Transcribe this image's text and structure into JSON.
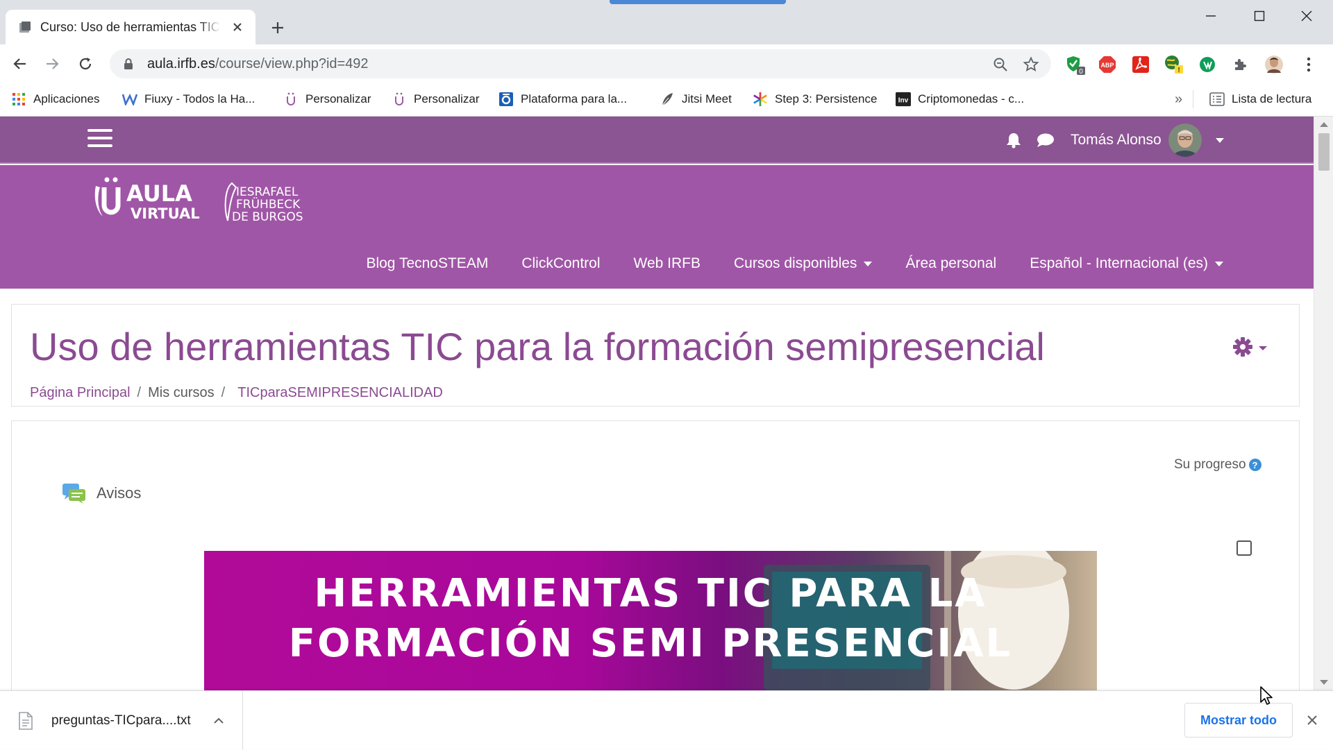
{
  "browser": {
    "tab_title": "Curso: Uso de herramientas TIC para la formación semipresencial",
    "url_host": "aula.irfb.es",
    "url_path": "/course/view.php?id=492",
    "bookmarks": [
      {
        "label": "Aplicaciones",
        "icon": "apps-grid-icon"
      },
      {
        "label": "Fiuxy - Todos la Ha...",
        "icon": "w-logo-icon"
      },
      {
        "label": "Personalizar",
        "icon": "u-logo-icon"
      },
      {
        "label": "Personalizar",
        "icon": "u-logo-icon"
      },
      {
        "label": "Plataforma para la...",
        "icon": "o-logo-icon"
      },
      {
        "label": "Jitsi Meet",
        "icon": "feather-icon"
      },
      {
        "label": "Step 3: Persistence",
        "icon": "star-burst-icon"
      },
      {
        "label": "Criptomonedas - c...",
        "icon": "inv-logo-icon"
      }
    ],
    "reading_list_label": "Lista de lectura",
    "overflow_label": "»",
    "extension_badge": "0"
  },
  "moodle": {
    "user_name": "Tomás Alonso",
    "logo_text": [
      "AULA",
      "VIRTUAL"
    ],
    "school_logo_text": [
      "IESRAFAEL",
      "FRÜHBECK",
      "DE BURGOS"
    ],
    "menu": [
      {
        "label": "Blog TecnoSTEAM",
        "dropdown": false
      },
      {
        "label": "ClickControl",
        "dropdown": false
      },
      {
        "label": "Web IRFB",
        "dropdown": false
      },
      {
        "label": "Cursos disponibles",
        "dropdown": true
      },
      {
        "label": "Área personal",
        "dropdown": false
      },
      {
        "label": "Español - Internacional (es)",
        "dropdown": true
      }
    ],
    "course_title": "Uso de herramientas TIC para la formación semipresencial",
    "breadcrumb": {
      "home": "Página Principal",
      "my_courses": "Mis cursos",
      "course": "TICparaSEMIPRESENCIALIDAD",
      "separator": "/"
    },
    "progress_label": "Su progreso",
    "help_glyph": "?",
    "forum_label": "Avisos",
    "banner_lines": [
      "HERRAMIENTAS TIC PARA LA",
      "FORMACIÓN SEMI PRESENCIAL"
    ],
    "colors": {
      "navbar": "#8b5492",
      "header": "#a056a6",
      "title": "#8b4a92"
    }
  },
  "downloads": {
    "file_name": "preguntas-TICpara....txt",
    "show_all_label": "Mostrar todo"
  }
}
